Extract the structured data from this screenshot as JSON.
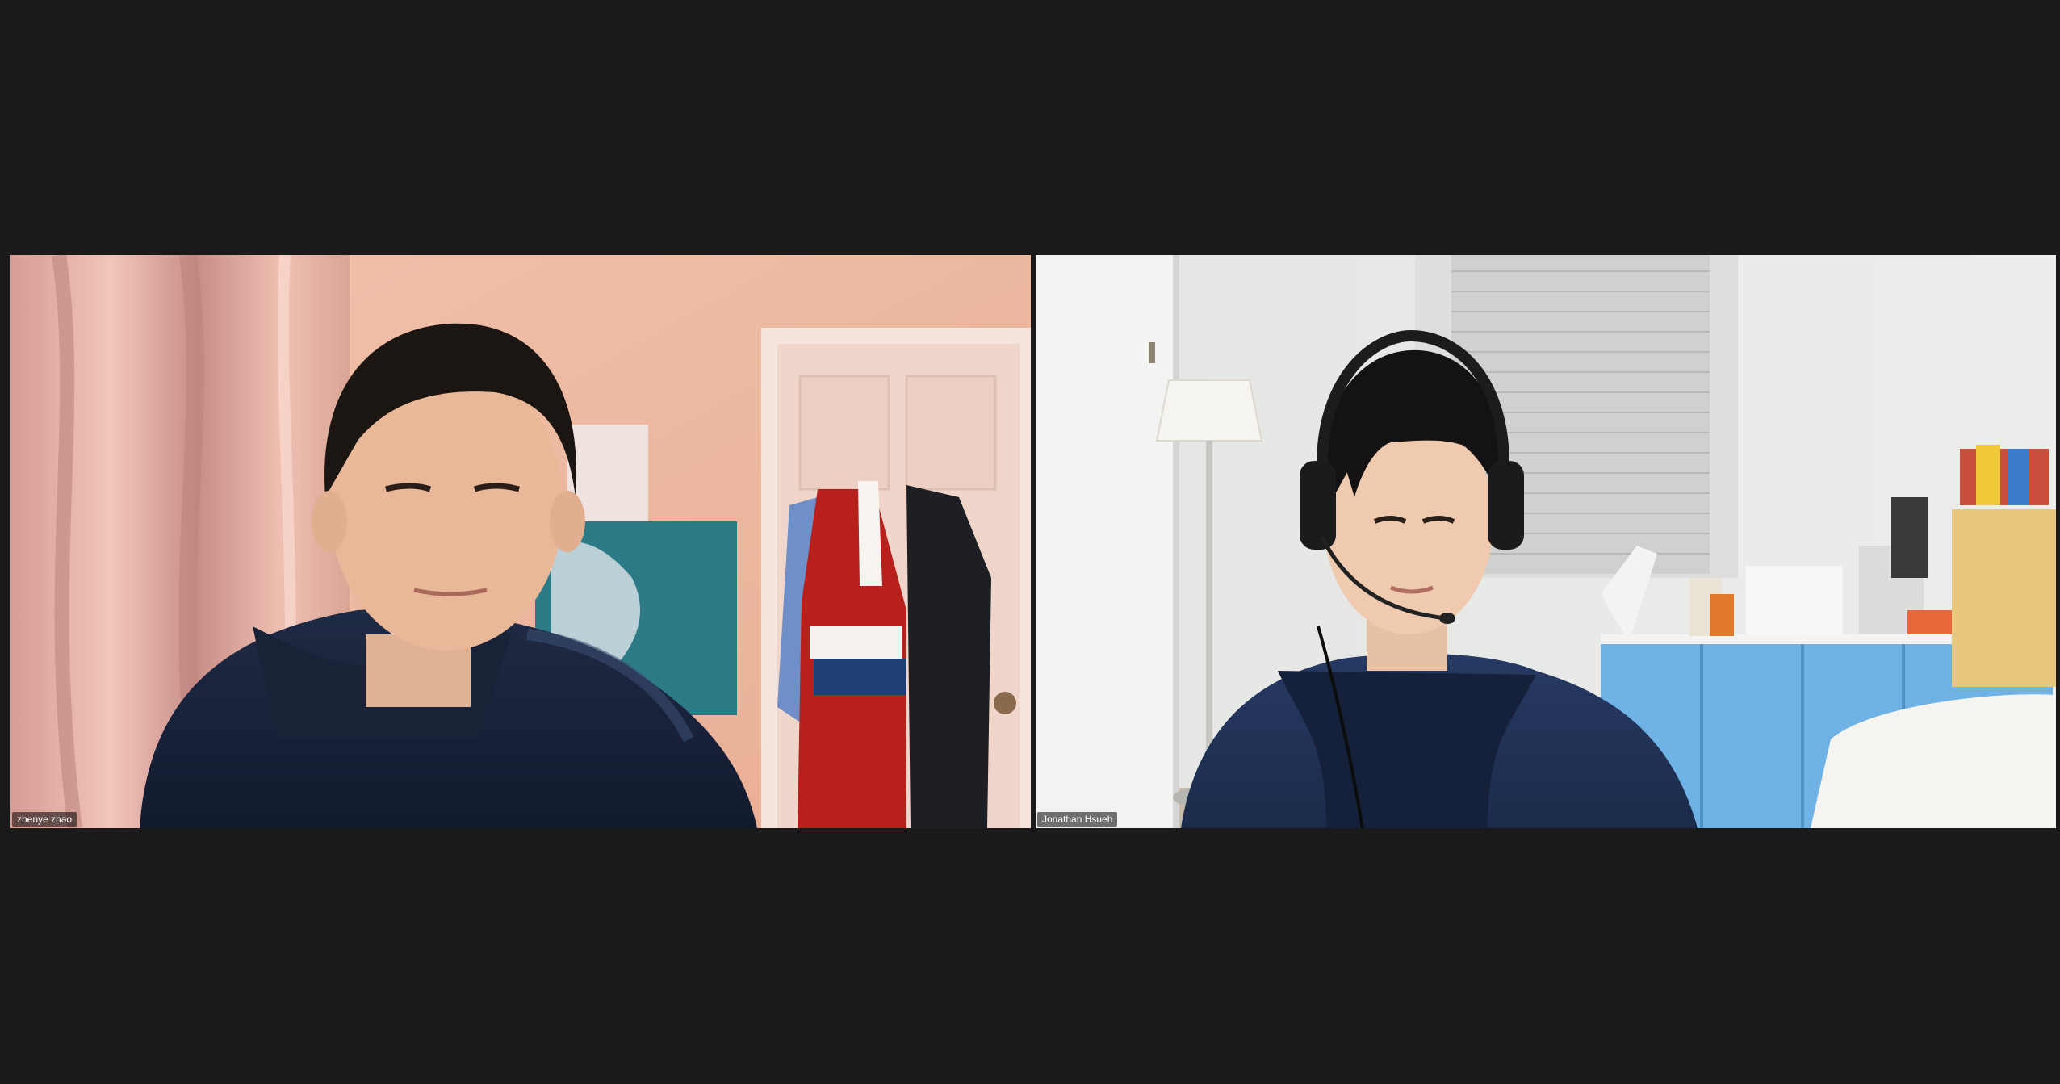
{
  "meeting": {
    "background_color": "#1a1a1a"
  },
  "participants": [
    {
      "name": "zhenye zhao"
    },
    {
      "name": "Jonathan Hsueh"
    }
  ]
}
